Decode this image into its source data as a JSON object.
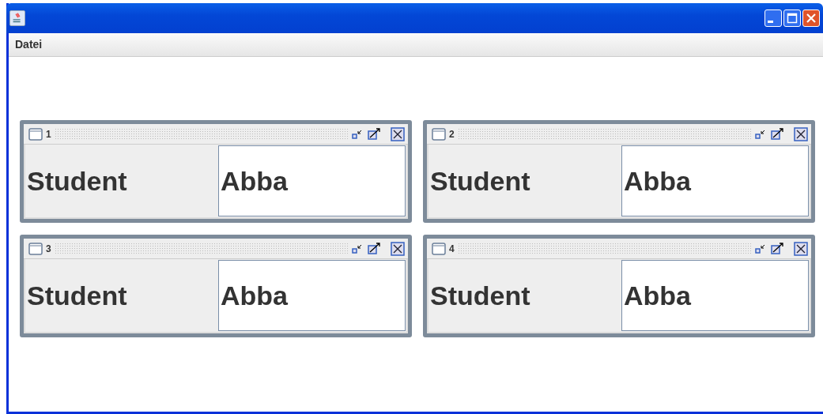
{
  "menu": [
    "Datei"
  ],
  "frames": [
    {
      "title": "1",
      "label": "Student",
      "value": "Abba"
    },
    {
      "title": "2",
      "label": "Student",
      "value": "Abba"
    },
    {
      "title": "3",
      "label": "Student",
      "value": "Abba"
    },
    {
      "title": "4",
      "label": "Student",
      "value": "Abba"
    }
  ]
}
